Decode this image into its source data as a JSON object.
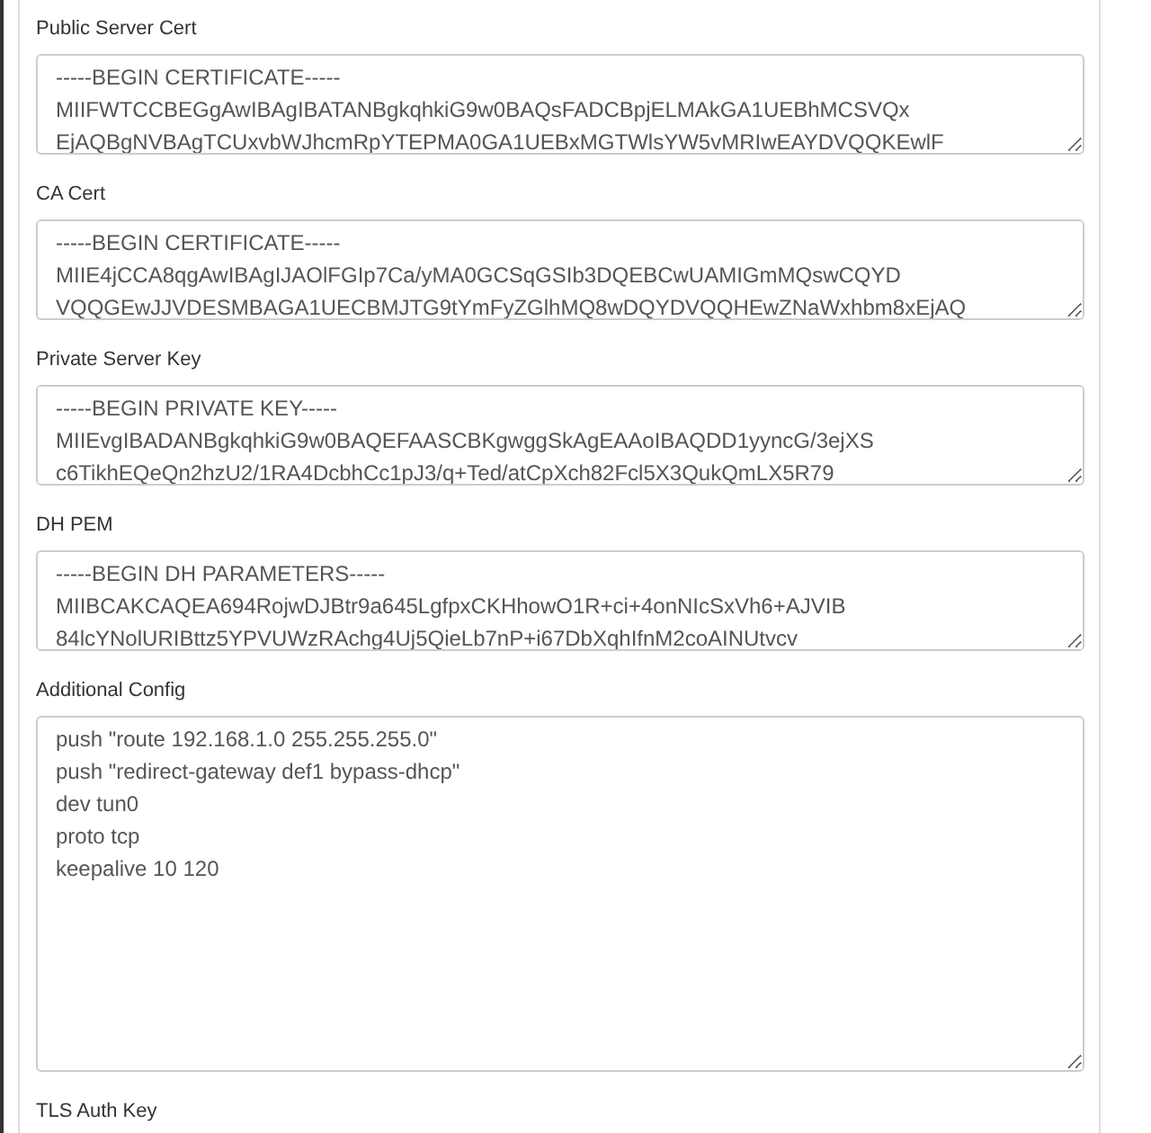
{
  "fields": [
    {
      "label": "Public Server Cert",
      "kind": "pem",
      "value": "-----BEGIN CERTIFICATE-----\nMIIFWTCCBEGgAwIBAgIBATANBgkqhkiG9w0BAQsFADCBpjELMAkGA1UEBhMCSVQx\nEjAQBgNVBAgTCUxvbWJhcmRpYTEPMA0GA1UEBxMGTWlsYW5vMRIwEAYDVQQKEwlF"
    },
    {
      "label": "CA Cert",
      "kind": "pem",
      "value": "-----BEGIN CERTIFICATE-----\nMIIE4jCCA8qgAwIBAgIJAOlFGIp7Ca/yMA0GCSqGSIb3DQEBCwUAMIGmMQswCQYD\nVQQGEwJJVDESMBAGA1UECBMJTG9tYmFyZGlhMQ8wDQYDVQQHEwZNaWxhbm8xEjAQ"
    },
    {
      "label": "Private Server Key",
      "kind": "pem",
      "value": "-----BEGIN PRIVATE KEY-----\nMIIEvgIBADANBgkqhkiG9w0BAQEFAASCBKgwggSkAgEAAoIBAQDD1yyncG/3ejXS\nc6TikhEQeQn2hzU2/1RA4DcbhCc1pJ3/q+Ted/atCpXch82Fcl5X3QukQmLX5R79"
    },
    {
      "label": "DH PEM",
      "kind": "pem",
      "value": "-----BEGIN DH PARAMETERS-----\nMIIBCAKCAQEA694RojwDJBtr9a645LgfpxCKHhowO1R+ci+4onNIcSxVh6+AJVIB\n84lcYNolURIBttz5YPVUWzRAchg4Uj5QieLb7nP+i67DbXqhIfnM2coAINUtvcv"
    },
    {
      "label": "Additional Config",
      "kind": "config",
      "value": "push \"route 192.168.1.0 255.255.255.0\"\npush \"redirect-gateway def1 bypass-dhcp\"\ndev tun0\nproto tcp\nkeepalive 10 120"
    },
    {
      "label": "TLS Auth Key"
    }
  ]
}
